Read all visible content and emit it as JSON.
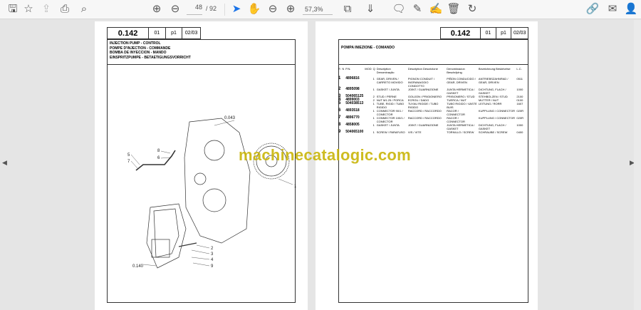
{
  "toolbar": {
    "icons": [
      "save-icon",
      "bookmark-star-icon",
      "upload-cloud-icon",
      "print-icon",
      "find-icon",
      "page-up-icon",
      "page-down-icon",
      "select-cursor-icon",
      "hand-icon",
      "zoom-out-icon",
      "zoom-in-icon",
      "fit-page-icon",
      "scroll-mode-icon",
      "comment-icon",
      "highlight-pen-icon",
      "sign-icon",
      "delete-icon",
      "rotate-icon",
      "share-link-icon",
      "email-icon",
      "account-icon"
    ],
    "current_page": "48",
    "total_pages": "/ 92",
    "zoom": "57,3%"
  },
  "left_page": {
    "code": "0.142",
    "c1": "01",
    "c2": "p1",
    "c3": "02/03",
    "titles": [
      "INJECTION PUMP - CONTROL",
      "POMPE D'INJECTION - COMMANDE",
      "BOMBA DE INYECCION - MANDO",
      "EINSPRITZPUMPE - BETAETIGUNGSVORRICHT"
    ],
    "callouts": {
      "c0043": "0.043",
      "c1": "1",
      "c5": "5",
      "c7": "7",
      "c8": "8",
      "c6": "6",
      "c2": "2",
      "c3": "3",
      "c4": "4",
      "c9": "9",
      "c0140": "0.140"
    }
  },
  "right_page": {
    "code": "0.142",
    "c1": "01",
    "c2": "p1",
    "c3": "02/03",
    "title": "POMPA INIEZIONE - COMANDO",
    "columns": [
      "R",
      "N",
      "P.N.",
      "MOD",
      "Q",
      "Description Denominação",
      "Description Descrizione",
      "Denominacion Beschrijving",
      "Bezeichnung Beskrivelse",
      "L.C."
    ],
    "rows": [
      {
        "n": "1",
        "pn": "4896816",
        "q": "1",
        "d1": "GEAR, DRIVEN / CARRETO MOVIDO",
        "d2": "PIGNON CONDUIT / INGRANAGGIO CONDOTTO",
        "d3": "PIÑON CONDUCIDO / GEAR, DRIVEN",
        "d4": "ANTRIEBSZAHNRAD / GEAR, DRIVEN",
        "lc": "0511"
      },
      {
        "n": "2",
        "pn": "4895098",
        "q": "1",
        "d1": "GASKET / JUNTA",
        "d2": "JOINT / GUARNIZIONE",
        "d3": "JUNTA HERMETICA / GASKET",
        "d4": "DICHTUNG, FLACH / GASKET",
        "lc": "1000"
      },
      {
        "n": "3",
        "pn": "504065125",
        "q": "2",
        "d1": "STUD / PERNE",
        "d2": "GOUJON / PRIGIONIERO",
        "d3": "PRISIONERO / STUD",
        "d4": "STEHBOLZEN / STUD",
        "lc": "2100"
      },
      {
        "n": "4",
        "pn": "4899003",
        "q": "2",
        "d1": "NUT M1.25 / PORCA",
        "d2": "ECROU / DADO",
        "d3": "TUERCA / NUT",
        "d4": "MUTTER / NUT",
        "lc": "0100"
      },
      {
        "n": "5",
        "pn": "504038513",
        "q": "1",
        "d1": "TUBE, RIGID / TUBO RIGIDO",
        "d2": "TUYAU RIGIDE / TUBO RIGIDO",
        "d3": "TUBO RIGIDO / VASTE BUIS",
        "d4": "LEITUNG / RORR",
        "lc": "1607"
      },
      {
        "n": "6",
        "pn": "4893518",
        "q": "1",
        "d1": "CONNECTOR 90/1 / CONECTOR",
        "d2": "RACCORD / RACCORDO",
        "d3": "RACOR / CONNECTOR",
        "d4": "KUPPLUNG / CONNECTOR",
        "lc": "020R"
      },
      {
        "n": "7",
        "pn": "4896770",
        "q": "1",
        "d1": "CONNECTOR 100/1 / CONECTOR",
        "d2": "RACCORD / RACCORDO",
        "d3": "RACOR / CONNECTOR",
        "d4": "KUPPLUNG / CONNECTOR",
        "lc": "020R"
      },
      {
        "n": "8",
        "pn": "4858005",
        "q": "1",
        "d1": "GASKET / JUNTA",
        "d2": "JOINT / GUARNIZIONE",
        "d3": "JUNTA HERMETICA / GASKET",
        "d4": "DICHTUNG, FLACH / GASKET",
        "lc": "1000"
      },
      {
        "n": "9",
        "pn": "504065100",
        "q": "1",
        "d1": "SCREW / PARAFUSO",
        "d2": "VIS / VITE",
        "d3": "TORNILLO / SCREW",
        "d4": "SCHRAUBE / SCREW",
        "lc": "0400"
      }
    ]
  },
  "watermark": "machinecatalogic.com"
}
